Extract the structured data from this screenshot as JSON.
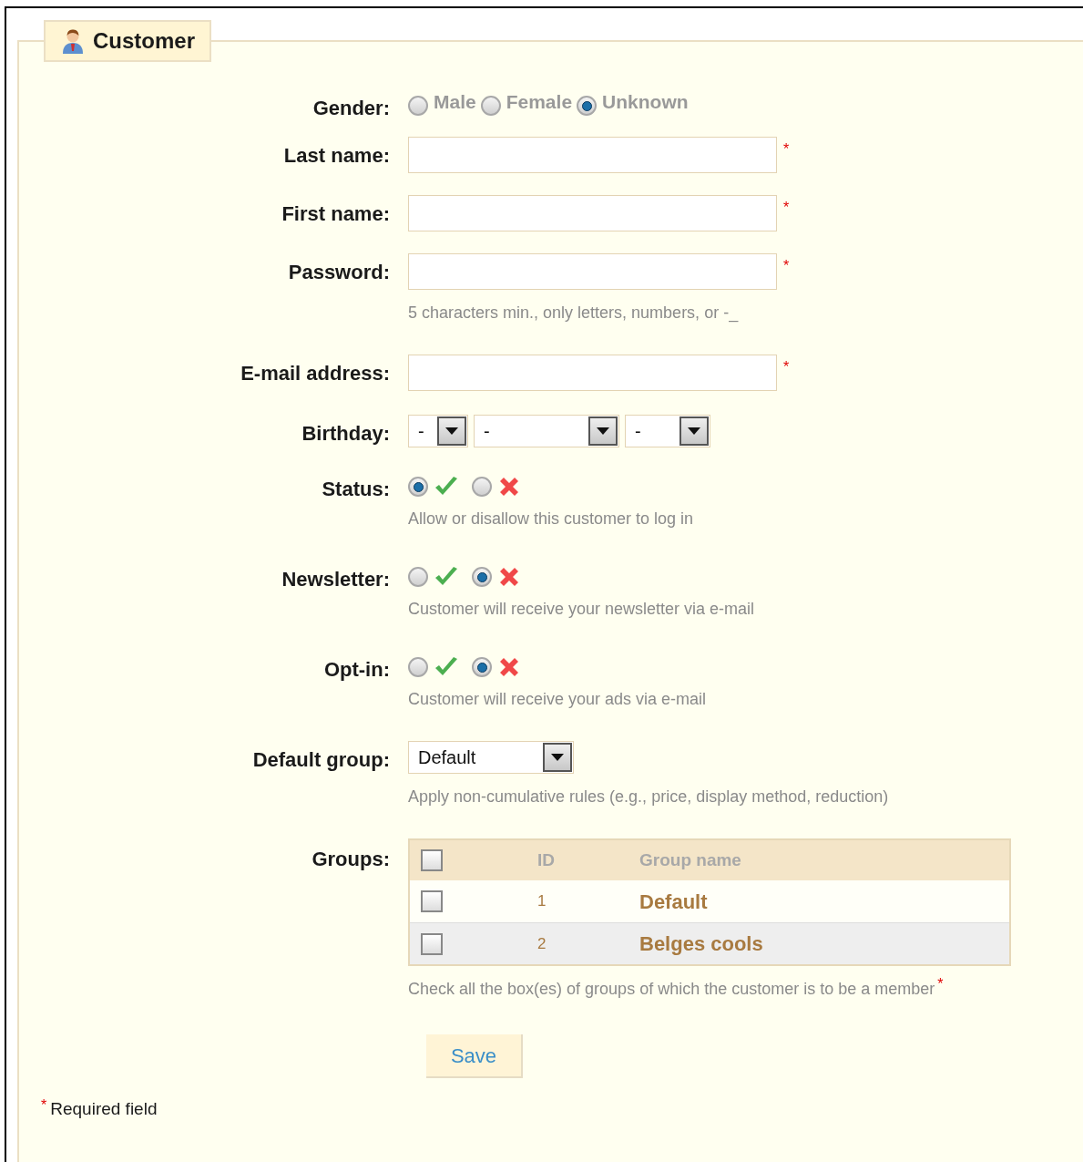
{
  "legend": {
    "title": "Customer"
  },
  "fields": [
    {
      "kind": "radio",
      "label": "Gender:",
      "options": [
        {
          "label": "Male",
          "selected": false
        },
        {
          "label": "Female",
          "selected": false
        },
        {
          "label": "Unknown",
          "selected": true
        }
      ]
    },
    {
      "kind": "text",
      "label": "Last name:",
      "required_mark": "*"
    },
    {
      "kind": "text",
      "label": "First name:",
      "required_mark": "*"
    },
    {
      "kind": "text",
      "label": "Password:",
      "required_mark": "*",
      "hint": "5 characters min., only letters, numbers, or -_"
    },
    {
      "kind": "text",
      "label": "E-mail address:",
      "required_mark": "*"
    },
    {
      "kind": "selects",
      "label": "Birthday:",
      "selects": [
        {
          "value": "-"
        },
        {
          "value": "-"
        },
        {
          "value": "-"
        }
      ]
    },
    {
      "kind": "toggle",
      "label": "Status:",
      "options": [
        {
          "kind": "check",
          "selected": true
        },
        {
          "kind": "cross",
          "selected": false
        }
      ],
      "hint": "Allow or disallow this customer to log in"
    },
    {
      "kind": "toggle",
      "label": "Newsletter:",
      "options": [
        {
          "kind": "check",
          "selected": false
        },
        {
          "kind": "cross",
          "selected": true
        }
      ],
      "hint": "Customer will receive your newsletter via e-mail"
    },
    {
      "kind": "toggle",
      "label": "Opt-in:",
      "options": [
        {
          "kind": "check",
          "selected": false
        },
        {
          "kind": "cross",
          "selected": true
        }
      ],
      "hint": "Customer will receive your ads via e-mail"
    },
    {
      "kind": "select",
      "label": "Default group:",
      "value": "Default",
      "hint": "Apply non-cumulative rules (e.g., price, display method, reduction)"
    },
    {
      "kind": "table",
      "label": "Groups:",
      "header_checked": false,
      "columns": [
        "ID",
        "Group name"
      ],
      "rows": [
        {
          "id": "1",
          "name": "Default",
          "checked": false
        },
        {
          "id": "2",
          "name": "Belges cools",
          "checked": false
        }
      ],
      "hint": "Check all the box(es) of groups of which the customer is to be a member",
      "required_mark": "*"
    }
  ],
  "save_button": "Save",
  "footnote": {
    "mark": "*",
    "text": "Required field"
  }
}
